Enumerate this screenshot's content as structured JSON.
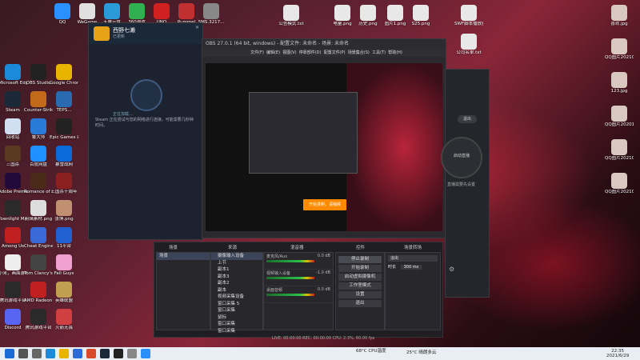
{
  "overlay_text": "",
  "desktop_left": [
    {
      "label": "Microsoft Edge",
      "color": "#1b8ad8"
    },
    {
      "label": "OBS Studio",
      "color": "#222"
    },
    {
      "label": "Google Chrome",
      "color": "#e8b400"
    },
    {
      "label": "Steam",
      "color": "#1b2838"
    },
    {
      "label": "Counter-Strike Global Off...",
      "color": "#c36a1a"
    },
    {
      "label": "TEPS...",
      "color": "#2a6bb0"
    },
    {
      "label": "回收站",
      "color": "#d0e0f0"
    },
    {
      "label": "鲁大师",
      "color": "#2a7bd8"
    },
    {
      "label": "Epic Games Launcher",
      "color": "#222"
    },
    {
      "label": "三国杀",
      "color": "#5a3a20"
    },
    {
      "label": "百度网盘",
      "color": "#1e90ff"
    },
    {
      "label": "暴雪战网",
      "color": "#0a6ad8"
    },
    {
      "label": "Adobe Premiere...",
      "color": "#220b3a"
    },
    {
      "label": "Romance of the Three...",
      "color": "#4a2a18"
    },
    {
      "label": "三国杀十周年",
      "color": "#8a2020"
    },
    {
      "label": "Townlight Manager",
      "color": "#2a2a2a"
    },
    {
      "label": "剪辑素材.png",
      "color": "#ddd"
    },
    {
      "label": "张博.png",
      "color": "#c09070"
    },
    {
      "label": "Among Us",
      "color": "#c02020"
    },
    {
      "label": "Cheat Engine",
      "color": "#3a6ad8"
    },
    {
      "label": "11平台",
      "color": "#2060d0"
    },
    {
      "label": "小米，画面游戏...",
      "color": "#eee"
    },
    {
      "label": "Tom Clancy's Ra...",
      "color": "#444"
    },
    {
      "label": "Fall Guys",
      "color": "#f0a0d0"
    },
    {
      "label": "腾讯游戏平台",
      "color": "#2a2a2a"
    },
    {
      "label": "AMD Radeon Software",
      "color": "#c02020"
    },
    {
      "label": "英雄联盟",
      "color": "#c0a050"
    },
    {
      "label": "Discord",
      "color": "#5865f2"
    },
    {
      "label": "腾讯游戏平台",
      "color": "#2a2a2a"
    },
    {
      "label": "火箭无畏",
      "color": "#d04040"
    }
  ],
  "desktop_top": [
    {
      "label": "QQ",
      "color": "#2a90ff"
    },
    {
      "label": "WeGame",
      "color": "#e0e0e0"
    },
    {
      "label": "天翼云盘",
      "color": "#2a9ad8"
    },
    {
      "label": "360游戏",
      "color": "#30b050"
    },
    {
      "label": "UNO",
      "color": "#d02020"
    },
    {
      "label": "Pummel",
      "color": "#c03030"
    },
    {
      "label": "SMS.3217...",
      "color": "#888"
    }
  ],
  "desktop_right_files": [
    {
      "label": "公告模式.txt"
    },
    {
      "label": "电量.png"
    },
    {
      "label": "历史.png"
    },
    {
      "label": "图片1.png"
    },
    {
      "label": "S25.png"
    },
    {
      "label": "SWF脚本播放器.exe"
    },
    {
      "label": "公司名单.txt"
    }
  ],
  "desktop_far_right": [
    {
      "label": "喜欢.jpg"
    },
    {
      "label": "QQ图片20210527..."
    },
    {
      "label": "123.jpg"
    },
    {
      "label": "QQ图片20201117..."
    },
    {
      "label": "QQ图片20210102..."
    },
    {
      "label": "QQ图片20210111..."
    }
  ],
  "steam": {
    "title": "西野七濑",
    "subtitle": "已更新",
    "status": "正在加载…",
    "message": "Steam 正在尝试与您的网络进行连接。可能需要几秒钟时间。"
  },
  "obs": {
    "title": "OBS 27.0.1 (64 bit, windows) - 配置文件: 未命名 - 场景: 未命名",
    "menus": [
      "文件(F)",
      "编辑(E)",
      "视图(V)",
      "停靠部件(D)",
      "配置文件(P)",
      "场景集合(S)",
      "工具(T)",
      "帮助(H)"
    ],
    "panel_headers": {
      "scenes": "场景",
      "sources": "来源",
      "mixer": "混音器",
      "transitions": "场景转场",
      "controls": "控件"
    },
    "scene": "场景",
    "preview_label": "未选择场景",
    "sources": [
      "摄像输入设备",
      "上节",
      "副本1",
      "副本3",
      "副本2",
      "副本",
      "视频采集设备",
      "窗口采集 5",
      "窗口采集",
      "鼠标",
      "窗口采集",
      "窗口采集"
    ],
    "mixer": [
      {
        "name": "麦克风/Aux",
        "db": "0.0 dB"
      },
      {
        "name": "视频输入设备",
        "db": "-1.0 dB"
      },
      {
        "name": "桌面音频",
        "db": "0.0 dB"
      }
    ],
    "controls": [
      "停止录制",
      "开始录制",
      "启动虚拟摄像机",
      "工作室模式",
      "设置",
      "退出"
    ],
    "transition": {
      "type": "淡出",
      "duration_label": "时长",
      "duration": "300 ms"
    },
    "orange_button": "开始录制，请稍候",
    "statusbar": "LIVE: 00:00:00   REC: 00:00:00   CPU: 2.3%, 60.00 fps"
  },
  "live_panel": {
    "pill": "退出",
    "ring": "启动直播",
    "note": "直播需要先设置"
  },
  "taskbar": {
    "weather": "25°C 晴朗多云",
    "time": "22:35",
    "date": "2021/6/29",
    "cpu": "68°C CPU温度",
    "icons": [
      "start",
      "search",
      "task-view",
      "edge",
      "explorer",
      "store",
      "chrome",
      "steam",
      "obs",
      "wegame",
      "qq"
    ]
  }
}
